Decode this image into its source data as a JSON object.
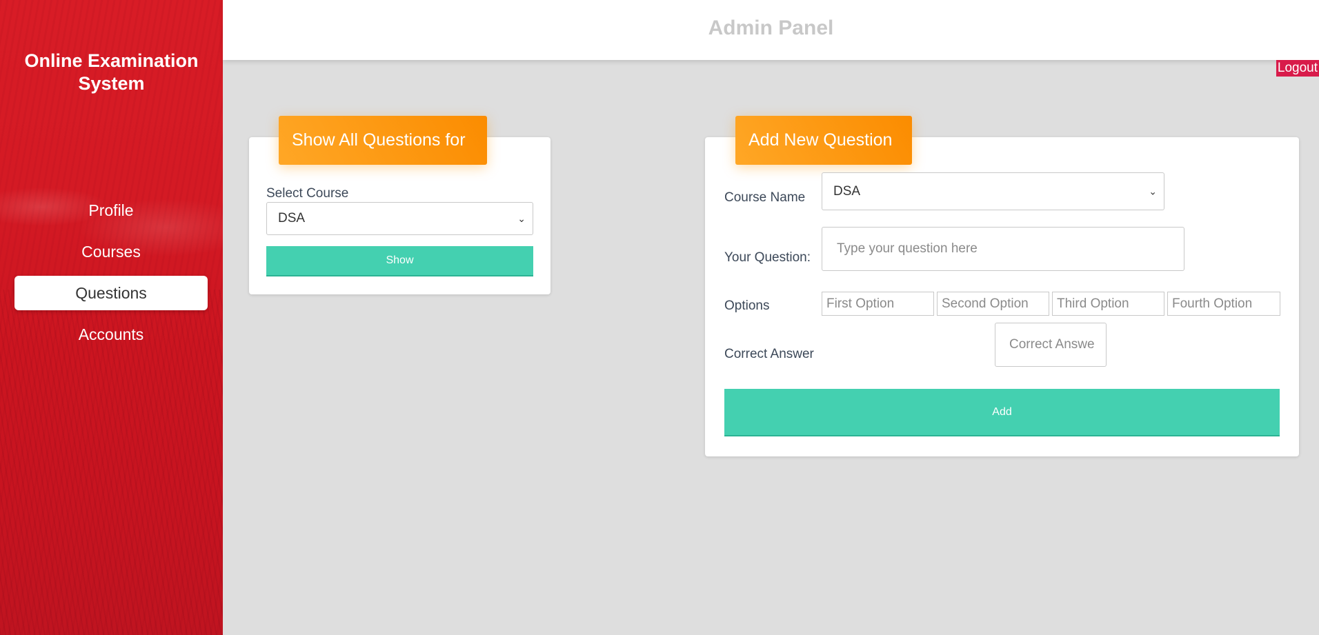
{
  "sidebar": {
    "brand": "Online Examination System",
    "items": [
      {
        "label": "Profile"
      },
      {
        "label": "Courses"
      },
      {
        "label": "Questions"
      },
      {
        "label": "Accounts"
      }
    ]
  },
  "header": {
    "title": "Admin Panel",
    "logout": "Logout"
  },
  "show_card": {
    "header": "Show All Questions for",
    "select_label": "Select Course",
    "selected_course": "DSA",
    "button": "Show"
  },
  "add_card": {
    "header": "Add New Question",
    "course_label": "Course Name",
    "selected_course": "DSA",
    "question_label": "Your Question:",
    "question_placeholder": "Type your question here",
    "options_label": "Options",
    "options": [
      "First Option",
      "Second Option",
      "Third Option",
      "Fourth Option"
    ],
    "answer_label": "Correct Answer",
    "answer_placeholder": "Correct Answe",
    "button": "Add"
  },
  "colors": {
    "sidebar_red": "#d41a24",
    "header_orange": "#fb8c00",
    "button_teal": "#44d0b0",
    "logout_pink": "#d81b4a"
  }
}
